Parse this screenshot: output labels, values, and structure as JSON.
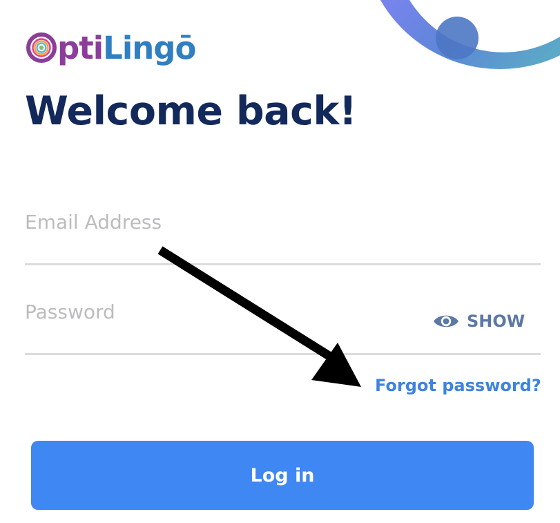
{
  "brand": {
    "name_part1": "pti",
    "name_part2": "Lingō",
    "colors": {
      "opti": "#8c3d99",
      "lingo": "#2f7fc1"
    }
  },
  "title": "Welcome back!",
  "form": {
    "email_placeholder": "Email Address",
    "password_placeholder": "Password",
    "show_label": "SHOW",
    "forgot_label": "Forgot password?",
    "login_label": "Log in"
  },
  "icons": {
    "logo": "optilingo-logo-icon",
    "show": "eye-icon",
    "annotation": "arrow-pointer-icon"
  },
  "colors": {
    "title": "#13295b",
    "primary": "#3f87f3",
    "link": "#3e83e0",
    "show": "#5c78a7",
    "placeholder": "#bcbcc0",
    "divider": "#dcdcdf"
  }
}
